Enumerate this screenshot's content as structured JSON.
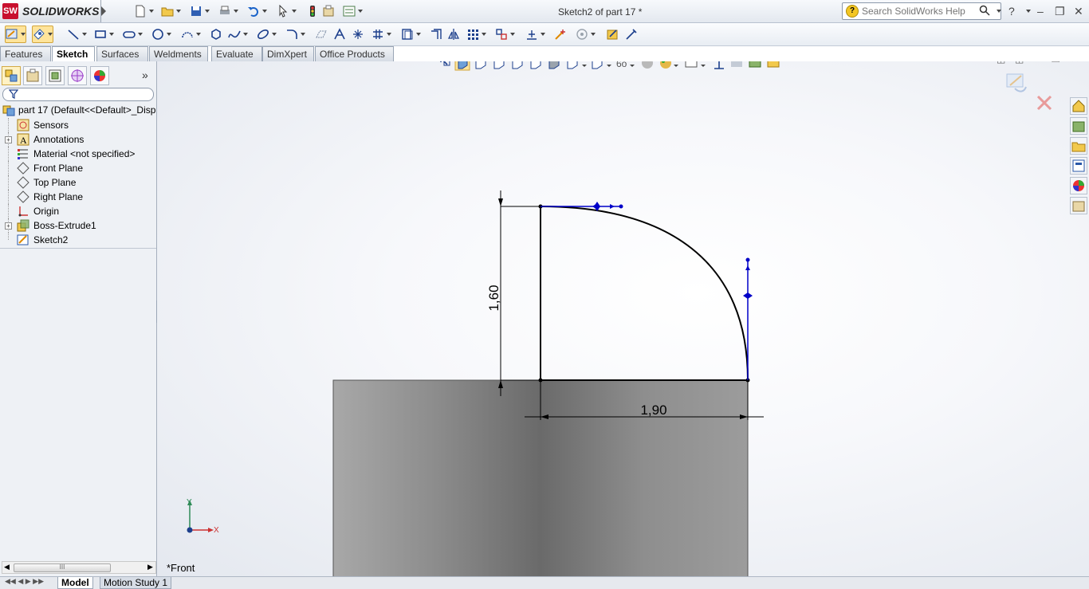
{
  "app": {
    "logo_mark": "SW",
    "logo_text": "SOLIDWORKS",
    "document_title": "Sketch2 of part 17 *"
  },
  "search": {
    "placeholder": "Search SolidWorks Help"
  },
  "command_tabs": [
    {
      "label": "Features"
    },
    {
      "label": "Sketch"
    },
    {
      "label": "Surfaces"
    },
    {
      "label": "Weldments"
    },
    {
      "label": "Evaluate"
    },
    {
      "label": "DimXpert"
    },
    {
      "label": "Office Products"
    }
  ],
  "active_command_tab": "Sketch",
  "feature_tree": {
    "filter_icon": "filter-icon",
    "items": [
      {
        "label": "part 17  (Default<<Default>_Disp",
        "icon": "part-icon",
        "expandable": false
      },
      {
        "label": "Sensors",
        "icon": "sensor-icon",
        "expandable": false
      },
      {
        "label": "Annotations",
        "icon": "annotation-icon",
        "expandable": true
      },
      {
        "label": "Material <not specified>",
        "icon": "material-icon",
        "expandable": false
      },
      {
        "label": "Front Plane",
        "icon": "plane-icon",
        "expandable": false
      },
      {
        "label": "Top Plane",
        "icon": "plane-icon",
        "expandable": false
      },
      {
        "label": "Right Plane",
        "icon": "plane-icon",
        "expandable": false
      },
      {
        "label": "Origin",
        "icon": "origin-icon",
        "expandable": false
      },
      {
        "label": "Boss-Extrude1",
        "icon": "extrude-icon",
        "expandable": true
      },
      {
        "label": "Sketch2",
        "icon": "sketch-icon",
        "expandable": false
      }
    ]
  },
  "scrollbar_thumb": "III",
  "sketch": {
    "dim_vertical": "1,60",
    "dim_horizontal": "1,90",
    "view_name": "*Front",
    "axis_x": "X",
    "axis_y": "Y"
  },
  "bottom_tabs": [
    {
      "label": "Model"
    },
    {
      "label": "Motion Study 1"
    }
  ],
  "colors": {
    "accent_active": "#ffe49a",
    "sketch_blue": "#0000c8",
    "body_gray": "#7a7a7a",
    "logo_red": "#c8102e"
  }
}
